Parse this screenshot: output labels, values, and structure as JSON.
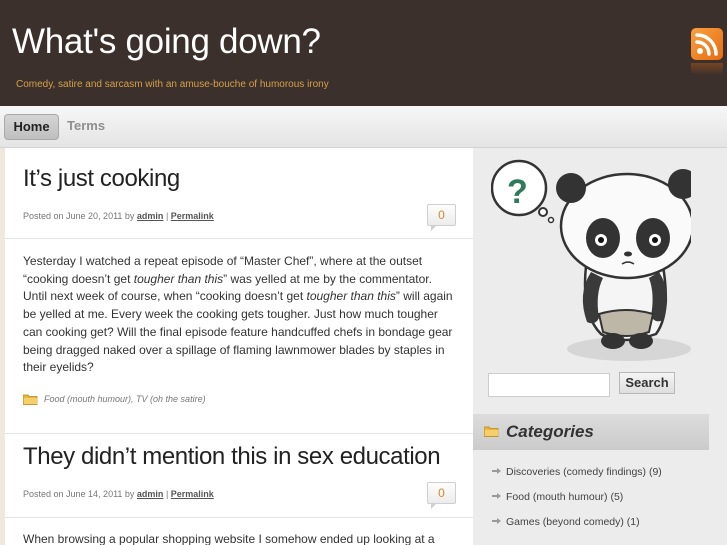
{
  "header": {
    "site_title": "What's going down?",
    "tagline": "Comedy, satire and sarcasm with an amuse-bouche of humorous irony",
    "rss_icon": "rss-feed-icon"
  },
  "nav": {
    "home": "Home",
    "terms": "Terms"
  },
  "posts": [
    {
      "title": "It’s just cooking",
      "meta_prefix": "Posted on June 20, 2011 by ",
      "author": "admin",
      "separator": " | ",
      "permalink": "Permalink",
      "comments": "0",
      "body": [
        "Yesterday I watched a repeat episode of “Master Chef”, where at the outset",
        "“cooking doesn’t get ",
        "tougher than this",
        "” was yelled at me by the commentator. Until next week of course, when “cooking doesn’t get ",
        "tougher than this",
        "” will again be yelled at me. Every week the cooking gets tougher. Just how much tougher can cooking get? Will the final episode feature handcuffed chefs in bondage gear being dragged naked over a spillage of flaming lawnmower blades by staples in their eyelids?"
      ],
      "categories": "Food (mouth humour), TV (oh the satire)"
    },
    {
      "title": "They didn’t mention this in sex education",
      "meta_prefix": "Posted on June 14, 2011 by ",
      "author": "admin",
      "separator": " | ",
      "permalink": "Permalink",
      "comments": "0",
      "body_first_line": "When browsing a popular shopping website I somehow ended up looking at a book"
    }
  ],
  "sidebar": {
    "search_placeholder": "",
    "search_button": "Search",
    "categories_title": "Categories",
    "categories": [
      "Discoveries (comedy findings) (9)",
      "Food (mouth humour) (5)",
      "Games (beyond comedy) (1)"
    ]
  },
  "colors": {
    "header_bg": "#3c302c",
    "tagline": "#d4a04a",
    "rss_orange": "#e66b12",
    "comment_count": "#d08a2a"
  }
}
